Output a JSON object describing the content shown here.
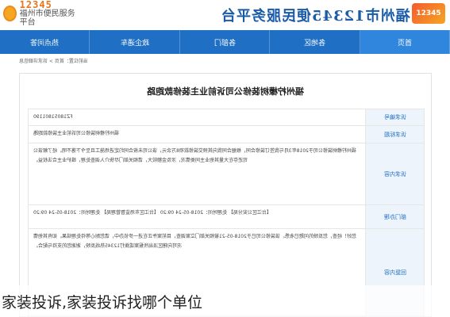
{
  "header": {
    "logo_number": "12345",
    "logo_sub": "福州市便民服务平台",
    "site_title": "福州市12345便民服务平台",
    "badge_text": "12345"
  },
  "nav": {
    "items": [
      {
        "label": "热点问答",
        "active": false
      },
      {
        "label": "政企通车",
        "active": false
      },
      {
        "label": "各部门",
        "active": false
      },
      {
        "label": "各地区",
        "active": false
      },
      {
        "label": "首页",
        "active": true
      }
    ]
  },
  "breadcrumb": "当前位置：首页 > 诉求详细信息",
  "content": {
    "title": "福州柠檬树装修公司诉前业主装修款跑路",
    "rows": [
      {
        "label": "诉求编号",
        "value": "FZ18051801190"
      },
      {
        "label": "诉求标题",
        "value": "福州柠檬树装修公司诉前业主装修款跑路"
      },
      {
        "label": "诉求内容",
        "value": "福州柠檬树装修公司于2018年3月与我签订装修合同，根据合同我向其预交装修款项8万余元，该公司未按合同约定进场施工且至今下落不明。经了解该公司还存在大量其他业主同类情况，涉及金额较大，请相关部门尽快介入调查处理，维护业主合法权益。"
      },
      {
        "label": "部门办理",
        "value": "【台江区公安分局】 处理时间：2018-05-24 09:20  【台江区市场监督管理局】 处理时间：2018-05-24 09:20"
      },
      {
        "label": "回复内容",
        "value": "您好！经查，您反映的问题已收悉。该装修公司已于2018-05-21被相关部门立案调查，目前案件正在进一步侦办中，请您耐心等待处理结果。如有其他情况可向辖区派出所报案或拨打12345热线反映，谢谢您的支持与配合。"
      }
    ]
  },
  "caption": "家装投诉,家装投诉找哪个单位"
}
